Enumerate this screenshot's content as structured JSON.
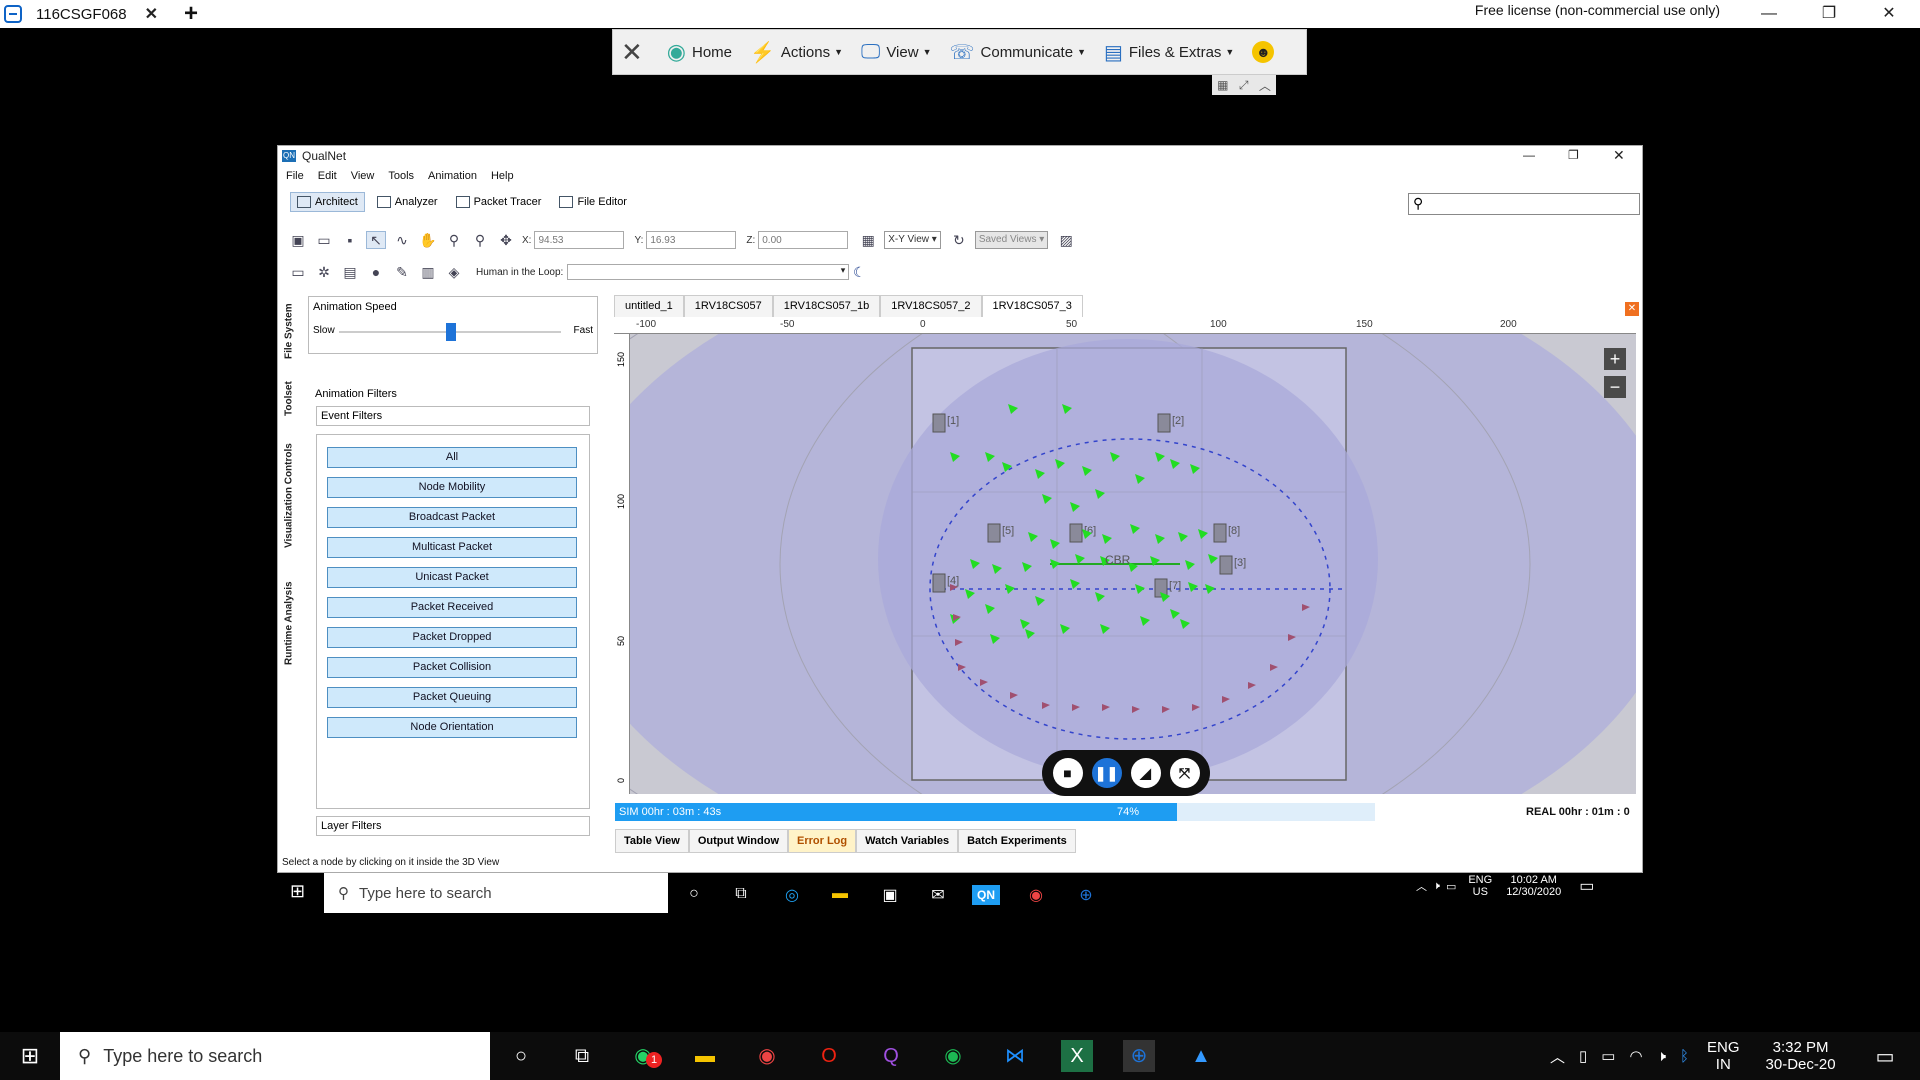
{
  "teamviewer": {
    "tab_name": "116CSGF068",
    "license_text": "Free license (non-commercial use only)",
    "toolbar": {
      "home": "Home",
      "actions": "Actions",
      "view": "View",
      "communicate": "Communicate",
      "files": "Files & Extras"
    }
  },
  "qualnet": {
    "window_title": "QualNet",
    "menu": [
      "File",
      "Edit",
      "View",
      "Tools",
      "Animation",
      "Help"
    ],
    "modes": {
      "architect": "Architect",
      "analyzer": "Analyzer",
      "packet_tracer": "Packet Tracer",
      "file_editor": "File Editor"
    },
    "coords": {
      "x_label": "X:",
      "x_value": "94.53",
      "y_label": "Y:",
      "y_value": "16.93",
      "z_label": "Z:",
      "z_value": "0.00"
    },
    "view_select": "X-Y View",
    "saved_views": "Saved Views",
    "hitl_label": "Human in the Loop:",
    "side_tabs": [
      "File System",
      "Toolset",
      "Visualization Controls",
      "Runtime Analysis"
    ],
    "animation_speed": {
      "title": "Animation Speed",
      "slow": "Slow",
      "fast": "Fast",
      "level": 0.5
    },
    "animation_filters_title": "Animation Filters",
    "event_filters_title": "Event Filters",
    "filters": [
      "All",
      "Node Mobility",
      "Broadcast Packet",
      "Multicast Packet",
      "Unicast Packet",
      "Packet Received",
      "Packet Dropped",
      "Packet Collision",
      "Packet Queuing",
      "Node Orientation"
    ],
    "layer_filters_title": "Layer Filters",
    "file_tabs": [
      "untitled_1",
      "1RV18CS057",
      "1RV18CS057_1b",
      "1RV18CS057_2",
      "1RV18CS057_3"
    ],
    "ruler_x": [
      "-100",
      "-50",
      "0",
      "50",
      "100",
      "150",
      "200"
    ],
    "ruler_y": [
      "150",
      "100",
      "50",
      "0"
    ],
    "nodes": [
      "[1]",
      "[2]",
      "[3]",
      "[4]",
      "[5]",
      "[6]",
      "[7]",
      "[8]"
    ],
    "cbr_label": "CBR",
    "sim_time": "SIM 00hr : 03m : 43s",
    "progress_text": "74%",
    "progress_value": 74,
    "real_time": "REAL 00hr : 01m : 0",
    "bottom_tabs": [
      "Table View",
      "Output Window",
      "Error Log",
      "Watch Variables",
      "Batch Experiments"
    ],
    "status_text": "Select a node by clicking on it inside the 3D View"
  },
  "inner_taskbar": {
    "search_placeholder": "Type here to search",
    "lang_top": "ENG",
    "lang_bottom": "US",
    "time": "10:02 AM",
    "date": "12/30/2020"
  },
  "host_taskbar": {
    "search_placeholder": "Type here to search",
    "lang_top": "ENG",
    "lang_bottom": "IN",
    "time": "3:32 PM",
    "date": "30-Dec-20",
    "whatsapp_badge": "1"
  },
  "colors": {
    "accent": "#1e73d8",
    "progress": "#1e9df2",
    "filter_btn": "#cfe9fb",
    "canvas_bg": "#c9c9d2",
    "terrain": "#b3b3d9",
    "packet_green": "#22dd22"
  }
}
